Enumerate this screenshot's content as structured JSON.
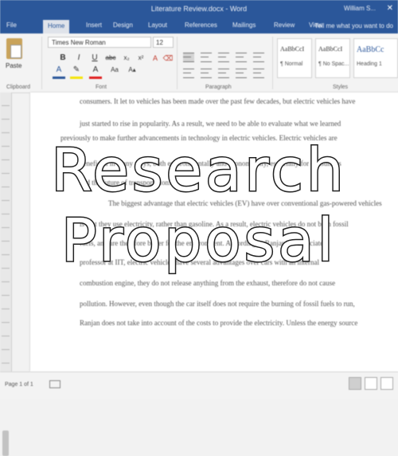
{
  "window": {
    "title": "Literature Review.docx - Word",
    "user": "William S...",
    "close": "✕"
  },
  "tabs": [
    "File",
    "Home",
    "Insert",
    "Design",
    "Layout",
    "References",
    "Mailings",
    "Review",
    "View"
  ],
  "active_tab": "Home",
  "tell_me": "Tell me what you want to do",
  "ribbon": {
    "paste_label": "Paste",
    "font_name": "Times New Roman",
    "font_size": "12",
    "bold": "B",
    "italic": "I",
    "underline": "U",
    "groups": [
      "Clipboard",
      "Font",
      "Paragraph",
      "Styles"
    ],
    "styles": [
      {
        "sample": "AaBbCcI",
        "name": "¶ Normal"
      },
      {
        "sample": "AaBbCcI",
        "name": "¶ No Spac..."
      },
      {
        "sample": "AaBbCc",
        "name": "Heading 1"
      }
    ]
  },
  "document": {
    "lines": [
      "consumers. It let to vehicles has been made over the past few decades, but electric vehicles have",
      "just started to rise in popularity. As a result, we need to be able to evaluate what we learned",
      "previously to make further advancements in technology in electric vehicles. Electric vehicles are",
      "beneficial in many ways, both environmentally and economically, especially for consumers",
      "and the future of transportation.",
      "The biggest advantage that electric vehicles (EV) have over conventional gas-powered vehicles",
      "is that they use electricity, rather than gasoline. As a result, electric vehicles do not burn fossil",
      "fuels, and are therefore better for the environment. According to Ranjan, an associate",
      "professor at IIT, electric vehicles have several advantages over cars with an internal",
      "combustion engine, they do not release anything from the exhaust, therefore do not cause",
      "pollution. However, even though the car itself does not require the burning of fossil fuels to run,",
      "Ranjan does not take into account of the costs to provide the electricity. Unless the energy source"
    ]
  },
  "status": {
    "page": "Page 1 of 1"
  },
  "overlay": {
    "line1": "Research",
    "line2": "Proposal"
  },
  "colors": {
    "word_blue": "#2b579a",
    "overlay_fill": "#ffffff",
    "overlay_stroke": "#222222"
  }
}
